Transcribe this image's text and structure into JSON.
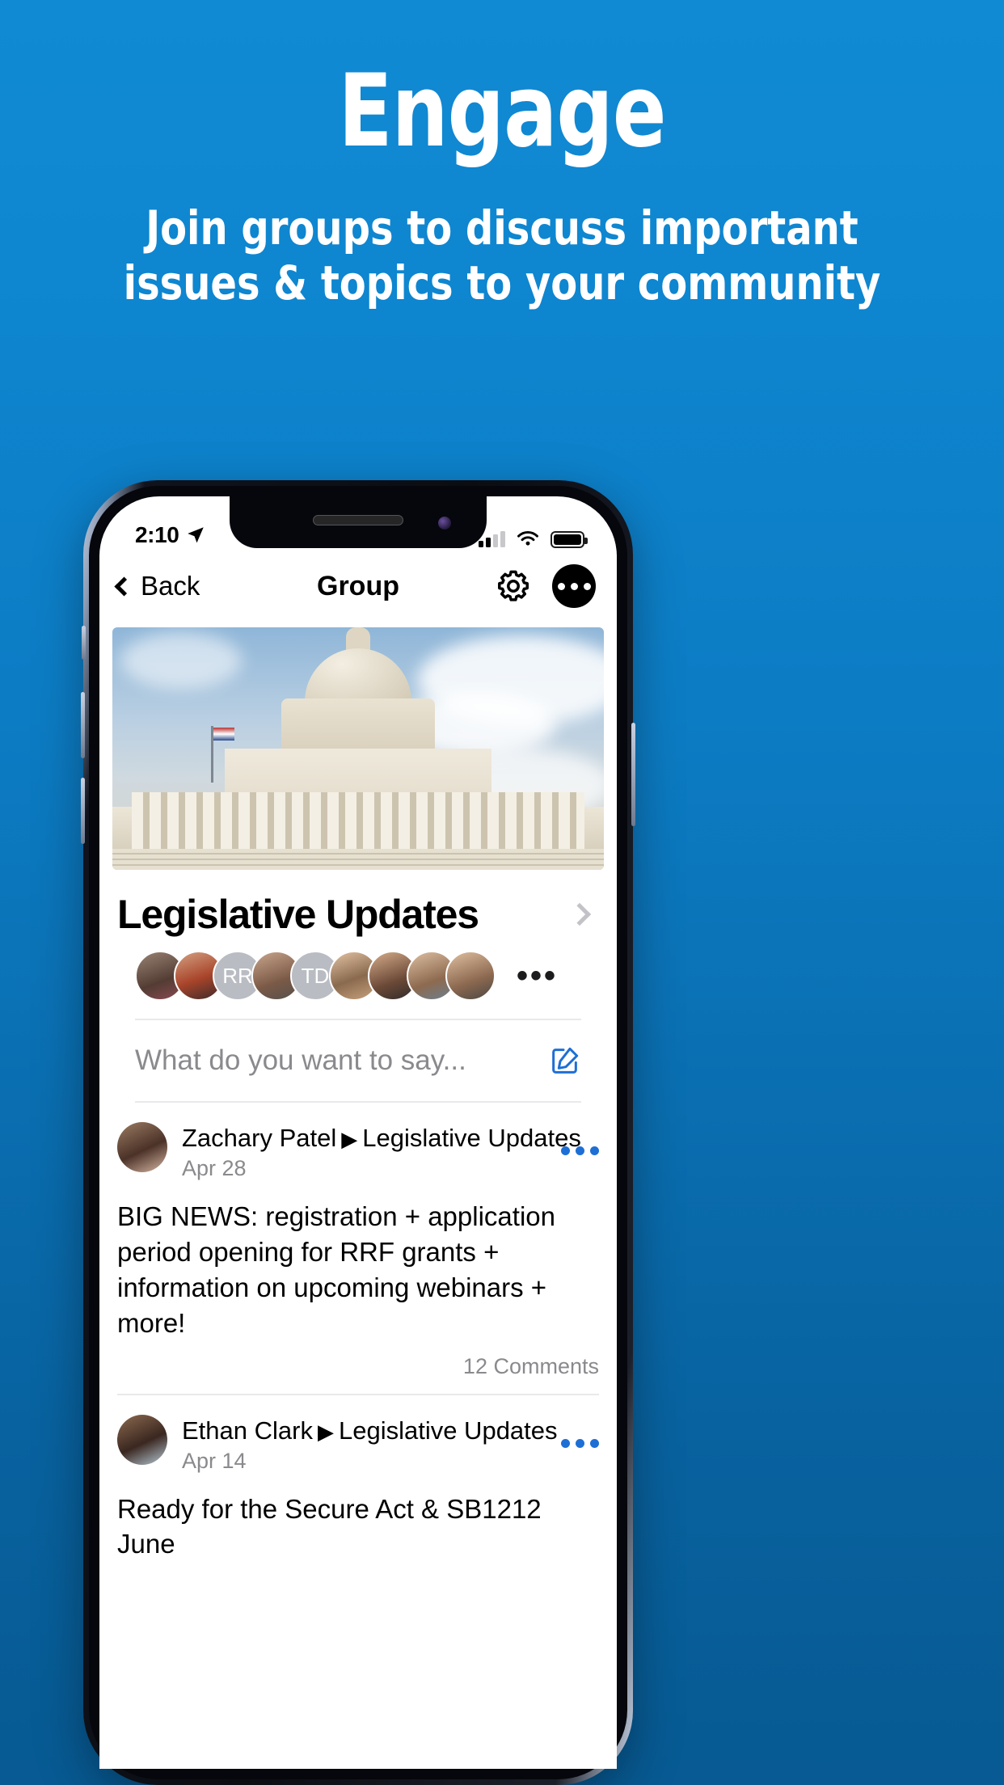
{
  "promo": {
    "title": "Engage",
    "subtitle_line1": "Join groups to discuss important",
    "subtitle_line2": "issues & topics to your community",
    "background_color": "#0c7cc4"
  },
  "phone": {
    "status_bar": {
      "time": "2:10",
      "location_icon": "location-arrow-icon",
      "signal_icon": "cellular-signal-icon",
      "signal_bars_filled": 2,
      "signal_bars_total": 4,
      "wifi_icon": "wifi-icon",
      "battery_icon": "battery-icon",
      "battery_level": 88
    },
    "nav": {
      "back_label": "Back",
      "back_icon": "chevron-left-icon",
      "title": "Group",
      "settings_icon": "gear-icon",
      "more_icon": "ellipsis-icon"
    },
    "group": {
      "cover_image": "us-capitol-building-photo",
      "name": "Legislative Updates",
      "disclosure_icon": "chevron-right-icon",
      "members": [
        {
          "type": "photo",
          "label": ""
        },
        {
          "type": "photo",
          "label": ""
        },
        {
          "type": "initials",
          "label": "RR"
        },
        {
          "type": "photo",
          "label": ""
        },
        {
          "type": "initials",
          "label": "TD"
        },
        {
          "type": "photo",
          "label": ""
        },
        {
          "type": "photo",
          "label": ""
        },
        {
          "type": "photo",
          "label": ""
        },
        {
          "type": "photo",
          "label": ""
        }
      ],
      "members_more": "•••"
    },
    "composer": {
      "placeholder": "What do you want to say...",
      "compose_icon": "compose-square-pencil-icon"
    },
    "posts": [
      {
        "author": "Zachary Patel",
        "separator": "▶",
        "group": "Legislative Updates",
        "date": "Apr 28",
        "body": "BIG NEWS: registration + application period opening for RRF grants + information on upcoming webinars + more!",
        "comments": "12 Comments",
        "more_icon": "ellipsis-icon"
      },
      {
        "author": "Ethan Clark",
        "separator": "▶",
        "group": "Legislative Updates",
        "date": "Apr 14",
        "body": "Ready for the Secure Act & SB1212 June",
        "comments": "",
        "more_icon": "ellipsis-icon"
      }
    ]
  },
  "colors": {
    "accent_blue": "#1d6fd6",
    "brand_blue": "#0c7cc4",
    "muted_gray": "#8a8a8e"
  }
}
